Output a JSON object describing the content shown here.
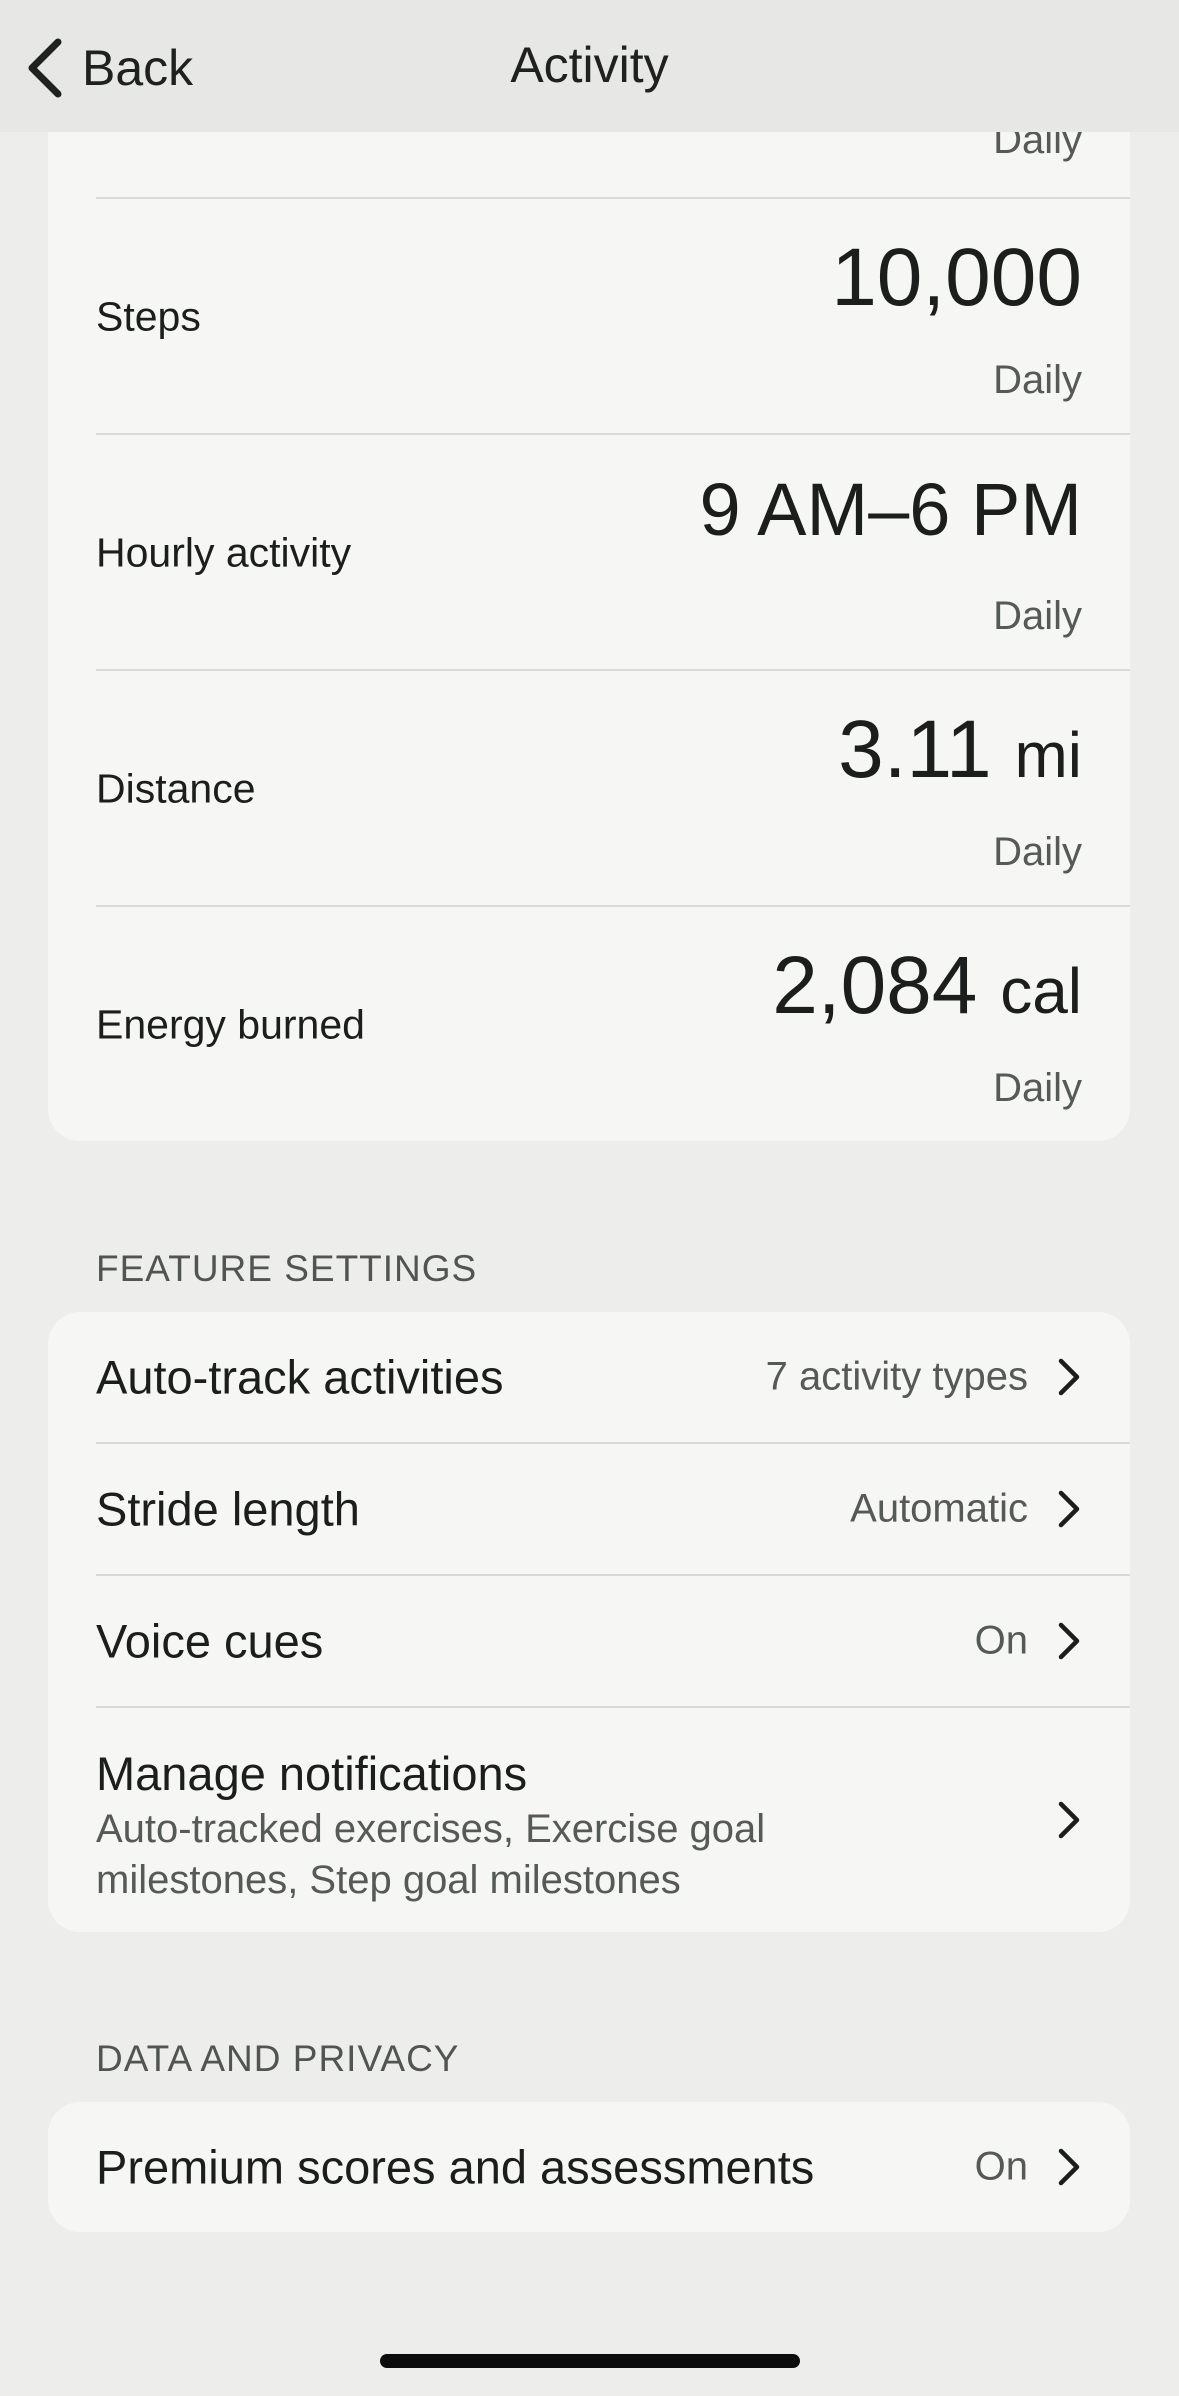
{
  "header": {
    "back_label": "Back",
    "title": "Activity"
  },
  "goals": {
    "partial_frequency": "Daily",
    "items": [
      {
        "label": "Steps",
        "value": "10,000",
        "unit": "",
        "frequency": "Daily"
      },
      {
        "label": "Hourly activity",
        "value": "9 AM–6 PM",
        "unit": "",
        "frequency": "Daily"
      },
      {
        "label": "Distance",
        "value": "3.11",
        "unit": "mi",
        "frequency": "Daily"
      },
      {
        "label": "Energy burned",
        "value": "2,084",
        "unit": "cal",
        "frequency": "Daily"
      }
    ]
  },
  "feature_settings": {
    "header": "FEATURE SETTINGS",
    "auto_track": {
      "label": "Auto-track activities",
      "value": "7 activity types"
    },
    "stride_length": {
      "label": "Stride length",
      "value": "Automatic"
    },
    "voice_cues": {
      "label": "Voice cues",
      "value": "On"
    },
    "manage_notifications": {
      "label": "Manage notifications",
      "detail": "Auto-tracked exercises, Exercise goal milestones, Step goal milestones"
    }
  },
  "data_privacy": {
    "header": "DATA AND PRIVACY",
    "premium_scores": {
      "label": "Premium scores and assessments",
      "value": "On"
    }
  },
  "icons": {
    "back": "chevron-left-icon",
    "row_arrow": "chevron-right-icon"
  },
  "colors": {
    "background": "#ededeb",
    "card": "#f6f7f5",
    "primary_text": "#1c1e1d",
    "secondary_text": "#555957"
  }
}
